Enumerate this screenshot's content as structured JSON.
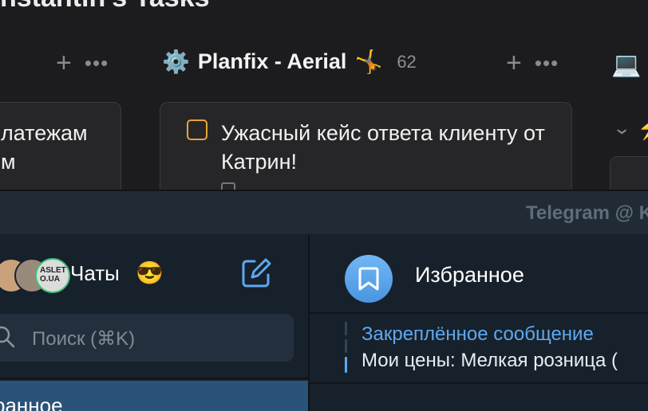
{
  "board": {
    "title": "nstantin's Tasks",
    "column": {
      "icon": "gear-emoji",
      "icon_glyph": "⚙️",
      "title": "Planfix - Aerial",
      "emoji": "🤸",
      "count": "62"
    },
    "left_card_text": "латежам\nм",
    "main_card_text": "Ужасный кейс ответа клиенту от Катрин!",
    "next_column_icon": "💻",
    "actions": {
      "plus": "+",
      "more": "•••"
    },
    "accent": "#e8a33c"
  },
  "telegram": {
    "window_title": "Telegram @ K",
    "sidebar": {
      "chats_label": "Чаты",
      "chats_emoji": "😎",
      "search_placeholder": "Поиск (⌘K)",
      "selected_chat_label": "ранное",
      "avatar_badge_text": "ASLET\nO.UA"
    },
    "chat": {
      "name": "Избранное",
      "pinned_title": "Закреплённое сообщение",
      "pinned_text": "Мои цены: Мелкая розница (",
      "accent": "#5fa8ee"
    }
  }
}
